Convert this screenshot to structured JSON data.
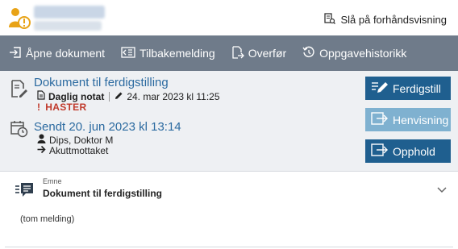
{
  "header": {
    "preview_toggle_label": "Slå på forhåndsvisning"
  },
  "toolbar": {
    "open_label": "Åpne dokument",
    "reply_label": "Tilbakemelding",
    "transfer_label": "Overfør",
    "history_label": "Oppgavehistorikk"
  },
  "task": {
    "title": "Dokument til ferdigstilling",
    "doc_type": "Daglig notat",
    "edited": "24. mar 2023 kl 11:25",
    "priority": "HASTER",
    "priority_mark": "!",
    "sent": "Sendt 20. jun 2023 kl 13:14",
    "sender": "Dips, Doktor M",
    "recipient": "Akuttmottaket"
  },
  "actions": {
    "finish_label": "Ferdigstill",
    "referral_label": "Henvisning",
    "stay_label": "Opphold"
  },
  "message": {
    "subject_label": "Emne",
    "subject": "Dokument til ferdigstilling",
    "body": "(tom melding)"
  },
  "colors": {
    "toolbar_bg": "#6f7b8a",
    "link_blue": "#2b6aa0",
    "primary_button": "#1f5f8f",
    "disabled_button": "#7fb1d0",
    "urgent_red": "#c0392b",
    "panel_bg": "#eef0f3"
  }
}
